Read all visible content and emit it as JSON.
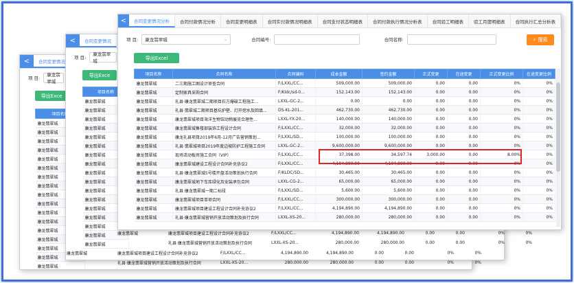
{
  "window_back": {
    "glyph": "<"
  },
  "back_tabs": {
    "contract_change": "合同变更情况"
  },
  "main_tabs": [
    "合同变更情况分析",
    "合同付款情况分析",
    "合同变更明细表",
    "合同实付款情况明细表",
    "合同支付状态明细表",
    "合同付款执行情况分析表",
    "合同验工明细表",
    "验工月度明细表",
    "合同执行汇总分析表"
  ],
  "filter": {
    "project_label": "项",
    "project_label2": "目:",
    "project_value": "康龙翡翠城",
    "contract_no_label": "合同编号:",
    "contract_name_label": "合同名称:",
    "search_label": "搜索"
  },
  "export_label": "导出Excel",
  "export_short": "导出Exce",
  "columns": [
    "项目名称",
    "合同名称",
    "合同编码",
    "成本金额",
    "签约金额",
    "正式变更",
    "在途变更",
    "正式变更比例",
    "在途变更比例"
  ],
  "rows": [
    [
      "康龙翡翠城",
      "二三期施工图设计审查合同",
      "F/LXXL/CC...",
      "509,000.00",
      "509,000.00",
      "0.00",
      "0.00",
      "0%",
      "0%"
    ],
    [
      "康龙翡翠城",
      "定制家具采购合同",
      "F/Kldc/sd-0...",
      "152,143.00",
      "152,143.00",
      "0.00",
      "0.00",
      "0%",
      "0%"
    ],
    [
      "康龙翡翠城",
      "礼县·康龙翡翠城二期项目石方爆破工程施工...",
      "LXXL-GC-2...",
      "0.00",
      "0.00",
      "0.00",
      "0.00",
      "0%",
      "0%"
    ],
    [
      "康龙翡翠城",
      "礼县·翡翠城二期项目基坑护壁、灯开挖水及回填...",
      "DS-KL-201...",
      "462,730.00",
      "462,730.00",
      "0.00",
      "0.00",
      "0%",
      "0%"
    ],
    [
      "康龙翡翠城",
      "康龙翡翠城项目海洋生物馆动物展览合理性...",
      "LXXL-YX-20...",
      "140,000.00",
      "140,000.00",
      "0.00",
      "0.00",
      "0%",
      "0%"
    ],
    [
      "康龙翡翠城",
      "康龙翡翠城售楼部装饰工程设计合同",
      "F/LXXL/CC...",
      "32,000.00",
      "32,000.00",
      "0.00",
      "0.00",
      "0%",
      "0%"
    ],
    [
      "康龙翡翠城",
      "康龙礼县项目2019年6月-12月广告营销策划...",
      "F/LXXL/SD...",
      "100,000.00",
      "100,000.00",
      "0.00",
      "0.00",
      "0%",
      "0%"
    ],
    [
      "康龙翡翠城",
      "礼县·翡翠城项目2019年度边坡防护工程施工合同",
      "LXXL-GC-2...",
      "9,600,000.00",
      "9,600,000.00",
      "0.00",
      "0.00",
      "0%",
      "0%"
    ],
    [
      "康龙翡翠城",
      "现场活动板房施工合同（VIP）",
      "F/LXXL/CC...",
      "37,398.00",
      "34,597.74",
      "3,000.00",
      "0.00",
      "8.00%",
      "0%"
    ],
    [
      "康龙翡翠城",
      "康龙翡翠城建设工程设计合同补充协议2",
      "F/LXXL/CC...",
      "4,194,890.00",
      "4,194,890.00",
      "0.00",
      "0.00",
      "0%",
      "0%"
    ],
    [
      "康龙翡翠城",
      "礼县·康龙翡翠城5号楼开盘活动策划执行合同",
      "F/KLDC/SD...",
      "30,465.00",
      "30,465.00",
      "0.00",
      "0.00",
      "0%",
      "0%"
    ],
    [
      "康龙翡翠城",
      "康龙翡翠城地下车库绿化及安装承包合同",
      "LXXL-CG-2...",
      "65,000.00",
      "65,000.00",
      "0.00",
      "0.00",
      "0%",
      "0%"
    ],
    [
      "康龙翡翠城",
      "礼县·康龙翡翠城一期二标段",
      "F/LXXL/SD...",
      "5,600.00",
      "5,600.00",
      "0.00",
      "0.00",
      "0%",
      "0%"
    ],
    [
      "康龙翡翠城",
      "康龙翡翠城项目单项合同",
      "F/LXXL/CC...",
      "300,000.00",
      "300,000.00",
      "0.00",
      "0.00",
      "0%",
      "0%"
    ],
    [
      "康龙翡翠城",
      "康龙翡翠城项目建设工程设计合同补充协议2",
      "F/LXXL/CC...",
      "4,194,890.00",
      "4,194,890.00",
      "0.00",
      "0.00",
      "0%",
      "0%"
    ],
    [
      "康龙翡翠城",
      "礼县·康龙翡翠城营销开放活动策划及执行合同",
      "LXXL-XS-20...",
      "280,000.00",
      "280,000.00",
      "0.00",
      "0.00",
      "0%",
      "0%"
    ]
  ],
  "back_column": {
    "header": "项目名称",
    "values": [
      "康龙翡翠城",
      "康龙翡翠城",
      "康龙翡翠城",
      "康龙翡翠城",
      "康龙翡翠城",
      "康龙翡翠城",
      "康龙翡翠城",
      "康龙翡翠城",
      "康龙翡翠城",
      "康龙翡翠城",
      "康龙翡翠城",
      "康龙翡翠城",
      "康龙翡翠城",
      "康龙翡翠城",
      "康龙翡翠城",
      "康龙翡翠城",
      "康龙翡翠城"
    ]
  },
  "fragments": [
    [
      "康龙翡翠城",
      "康龙翡翠城项目建设工程设计合同补充协议2",
      "F/LXXL/CC...",
      "4,194,890.00",
      "4,194,890.00",
      "0.00",
      "0.00",
      "0%",
      "0%"
    ],
    [
      "",
      "礼县·康龙翡翠城营销开放活动策划及执行合同",
      "LXXL-XS-20...",
      "280,000.00",
      "280,000.00",
      "0.00",
      "0.00",
      "0%",
      "0%"
    ],
    [
      "康龙翡翠城",
      "康龙翡翠城项目建设工程设计合同补充协议2",
      "F/LXXL/CC...",
      "4,194,890.00",
      "4,194,890.00",
      "0.00",
      "0.00",
      "0%",
      "0%"
    ],
    [
      "",
      "礼县·康龙翡翠城营销开放活动策划及执行合同",
      "LXXL-XS-20...",
      "280,000.00",
      "280,000.00",
      "0.00",
      "0.00",
      "0%",
      "0%"
    ]
  ],
  "colors": {
    "accent": "#4a8ee8",
    "export": "#3cb878",
    "search": "#ff8a1e",
    "highlight": "#e02424",
    "frame": "#3e6fd0"
  }
}
